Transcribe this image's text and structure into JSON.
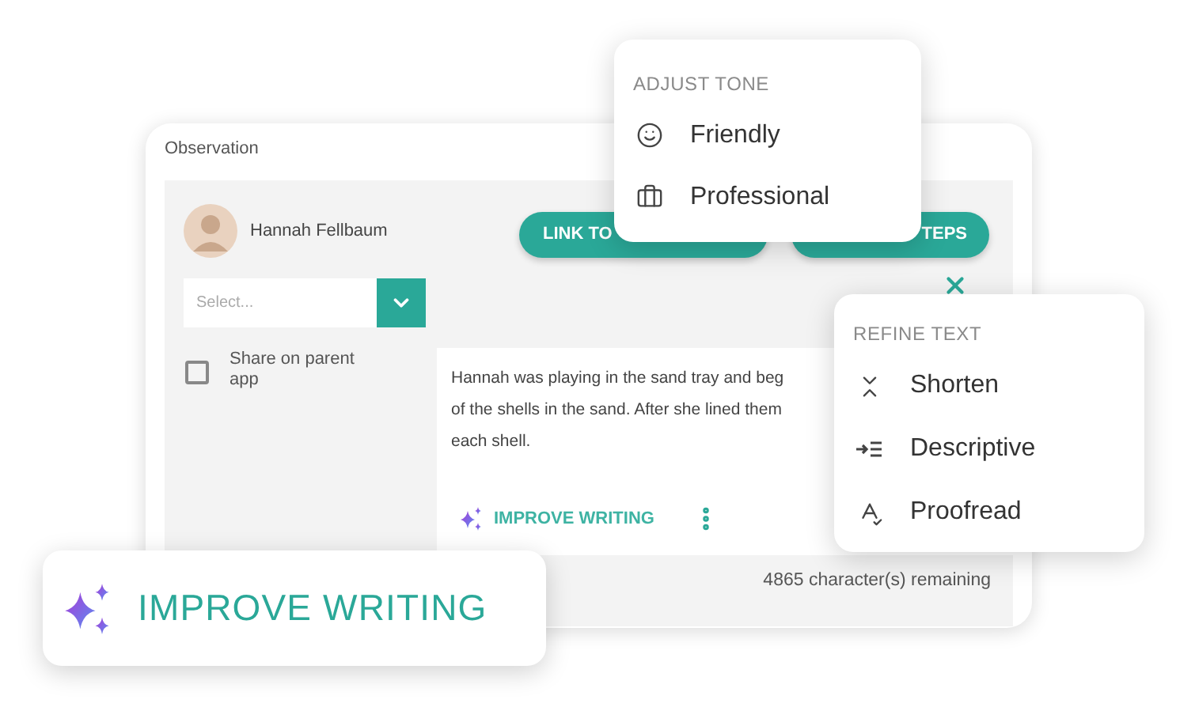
{
  "card": {
    "title": "Observation",
    "child": {
      "name": "Hannah Fellbaum"
    },
    "buttons": [
      {
        "label": "LINK TO"
      },
      {
        "label": "TEPS"
      }
    ],
    "select": {
      "placeholder": "Select..."
    },
    "share": {
      "label": "Share on parent app",
      "checked": false
    },
    "text_lines": [
      "Hannah was playing in the sand tray and beg",
      "of the shells in the sand. After she lined them",
      "each shell."
    ],
    "improve": {
      "label": "IMPROVE WRITING"
    },
    "remaining": "4865 character(s) remaining"
  },
  "tone_menu": {
    "header": "ADJUST TONE",
    "items": [
      {
        "kind": "smile",
        "label": "Friendly"
      },
      {
        "kind": "briefcase",
        "label": "Professional"
      }
    ]
  },
  "refine_menu": {
    "header": "REFINE TEXT",
    "items": [
      {
        "kind": "shorten",
        "label": "Shorten"
      },
      {
        "kind": "descriptive",
        "label": "Descriptive"
      },
      {
        "kind": "proofread",
        "label": "Proofread"
      }
    ]
  },
  "improve_card": {
    "label": "IMPROVE WRITING"
  }
}
